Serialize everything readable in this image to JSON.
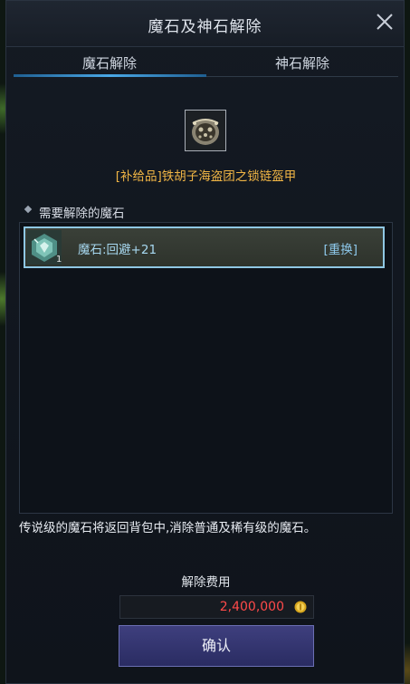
{
  "window": {
    "title": "魔石及神石解除",
    "close_icon": "close-icon"
  },
  "tabs": [
    {
      "label": "魔石解除",
      "active": true
    },
    {
      "label": "神石解除",
      "active": false
    }
  ],
  "item": {
    "icon": "chain-armor-icon",
    "name": "[补给品]铁胡子海盗团之锁链盔甲"
  },
  "section": {
    "label": "需要解除的魔石"
  },
  "stones": [
    {
      "icon": "magic-stone-icon",
      "count": "1",
      "label": "魔石:回避+21",
      "action": "[重换]"
    }
  ],
  "notice": "传说级的魔石将返回背包中,消除普通及稀有级的魔石。",
  "cost": {
    "label": "解除费用",
    "value": "2,400,000",
    "currency_icon": "gold-coin-icon"
  },
  "confirm_label": "确认",
  "colors": {
    "item_name": "#f0b545",
    "cost_value": "#ff4a4a",
    "accent": "#4aa8e6"
  }
}
